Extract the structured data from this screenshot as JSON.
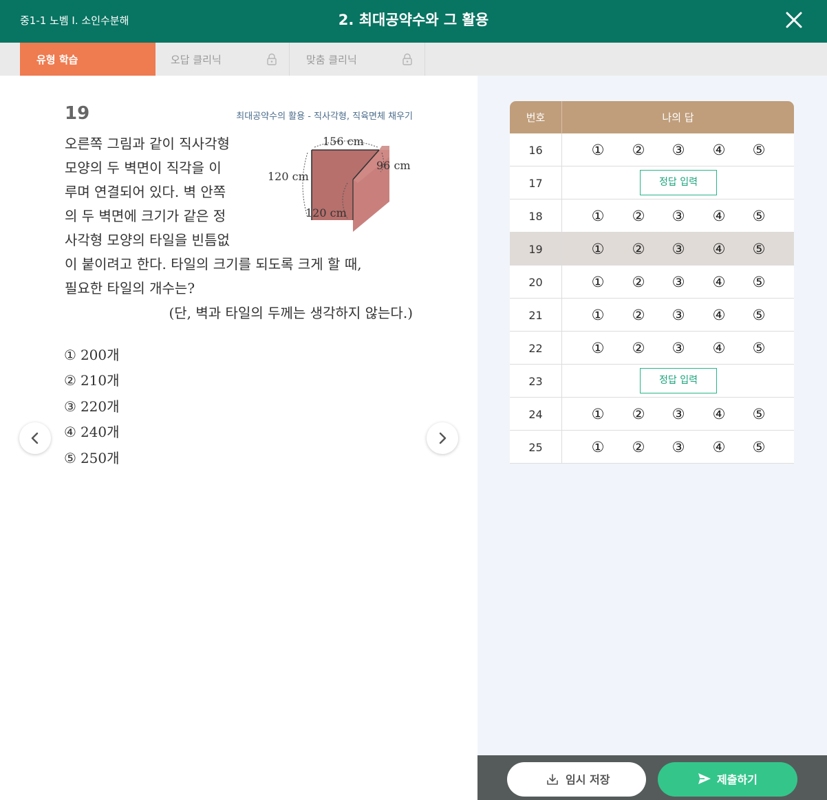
{
  "header": {
    "course": "중1-1 노벰 Ⅰ. 소인수분해",
    "title": "2. 최대공약수와 그 활용"
  },
  "tabs": [
    {
      "label": "유형 학습"
    },
    {
      "label": "오답 클리닉"
    },
    {
      "label": "맞춤 클리닉"
    }
  ],
  "question": {
    "number": "19",
    "topic": "최대공약수의 활용 - 직사각형, 직육면체 채우기",
    "lines": [
      "오른쪽 그림과 같이 직사각형",
      "모양의 두 벽면이 직각을 이",
      "루며 연결되어 있다. 벽 안쪽",
      "의 두 벽면에 크기가 같은 정",
      "사각형 모양의 타일을 빈틈없",
      "이 붙이려고 한다. 타일의 크기를 되도록 크게 할 때,",
      "필요한 타일의 개수는?",
      "(단, 벽과 타일의 두께는 생각하지 않는다.)"
    ],
    "figure_labels": {
      "top": "156 cm",
      "right": "96 cm",
      "left": "120 cm",
      "bottom": "120 cm"
    },
    "choices": [
      {
        "mark": "①",
        "text": "200개"
      },
      {
        "mark": "②",
        "text": "210개"
      },
      {
        "mark": "③",
        "text": "220개"
      },
      {
        "mark": "④",
        "text": "240개"
      },
      {
        "mark": "⑤",
        "text": "250개"
      }
    ]
  },
  "answer_sheet": {
    "header_number": "번호",
    "header_answer": "나의 답",
    "option_marks": [
      "①",
      "②",
      "③",
      "④",
      "⑤"
    ],
    "input_label": "정답 입력",
    "rows": [
      {
        "number": "16",
        "type": "choice"
      },
      {
        "number": "17",
        "type": "input"
      },
      {
        "number": "18",
        "type": "choice"
      },
      {
        "number": "19",
        "type": "choice",
        "current": true
      },
      {
        "number": "20",
        "type": "choice"
      },
      {
        "number": "21",
        "type": "choice"
      },
      {
        "number": "22",
        "type": "choice"
      },
      {
        "number": "23",
        "type": "input"
      },
      {
        "number": "24",
        "type": "choice"
      },
      {
        "number": "25",
        "type": "choice"
      }
    ]
  },
  "buttons": {
    "save": "임시 저장",
    "submit": "제출하기"
  },
  "colors": {
    "header": "#087462",
    "active_tab": "#ef7b50",
    "table_header": "#c09e7b",
    "submit": "#34c58b",
    "input_border": "#27b58a",
    "wall": "#b7706c"
  },
  "icons": [
    "close-icon",
    "lock-icon",
    "chevron-left-icon",
    "chevron-right-icon",
    "download-icon",
    "send-icon"
  ]
}
